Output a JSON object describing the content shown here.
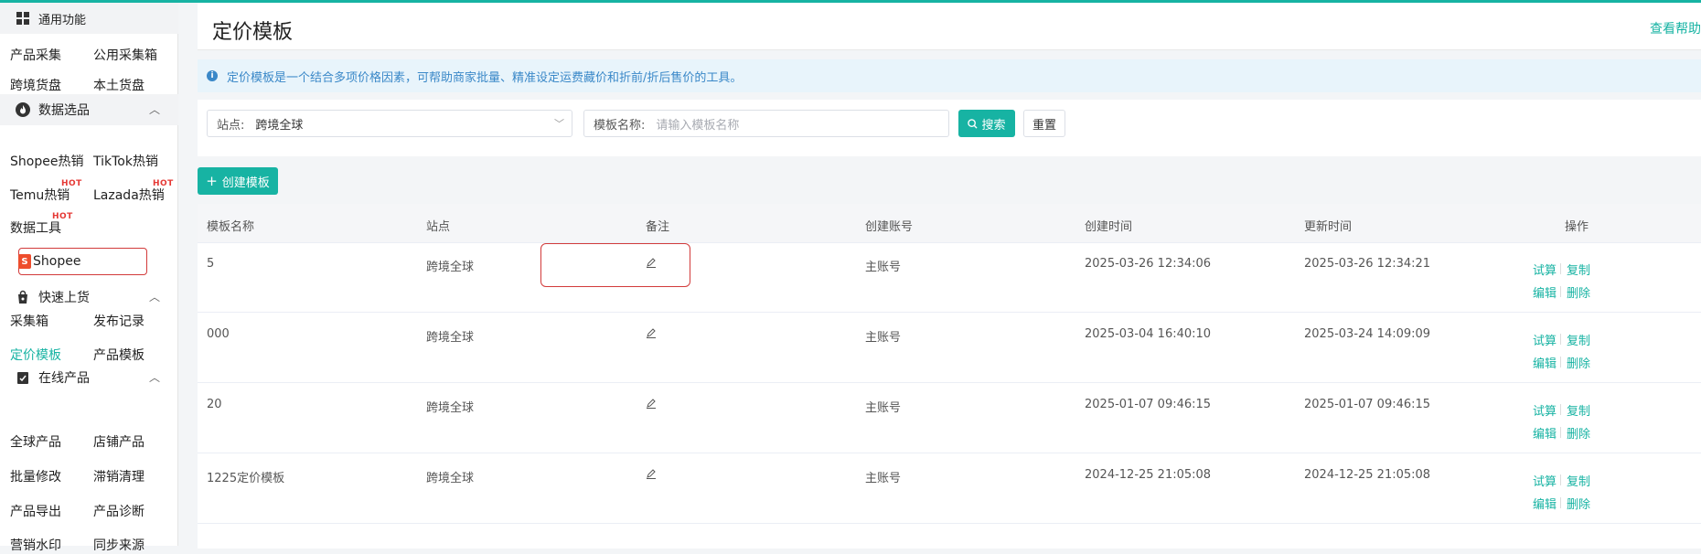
{
  "sidebar": {
    "general": "通用功能",
    "collect": "产品采集",
    "public_box": "公用采集箱",
    "cross_supply": "跨境货盘",
    "local_supply": "本土货盘",
    "data_select": "数据选品",
    "shopee_hot": "Shopee热销",
    "tiktok_hot": "TikTok热销",
    "temu_hot": "Temu热销",
    "lazada_hot": "Lazada热销",
    "data_tools": "数据工具",
    "hot_badge": "HOT",
    "shopee": "Shopee",
    "shopee_logo": "S",
    "quick_list": "快速上货",
    "collect_box": "采集箱",
    "publish_log": "发布记录",
    "pricing_tpl": "定价模板",
    "product_tpl": "产品模板",
    "online_products": "在线产品",
    "global_products": "全球产品",
    "shop_products": "店铺产品",
    "batch_edit": "批量修改",
    "stale_clean": "滞销清理",
    "product_export": "产品导出",
    "product_diag": "产品诊断",
    "marketing_wm": "营销水印",
    "sync_source": "同步来源"
  },
  "header": {
    "title": "定价模板",
    "help": "查看帮助"
  },
  "notice": {
    "icon": "i",
    "text": "定价模板是一个结合多项价格因素，可帮助商家批量、精准设定运费藏价和折前/折后售价的工具。"
  },
  "filter": {
    "site_label": "站点:",
    "site_value": "跨境全球",
    "name_label": "模板名称:",
    "name_placeholder": "请输入模板名称",
    "search": "搜索",
    "reset": "重置"
  },
  "create_button": "创建模板",
  "table": {
    "headers": [
      "模板名称",
      "站点",
      "备注",
      "创建账号",
      "创建时间",
      "更新时间",
      "操作"
    ],
    "actions": {
      "trial": "试算",
      "copy": "复制",
      "edit": "编辑",
      "delete": "删除"
    },
    "rows": [
      {
        "name": "5",
        "site": "跨境全球",
        "account": "主账号",
        "created": "2025-03-26 12:34:06",
        "updated": "2025-03-26 12:34:21"
      },
      {
        "name": "000",
        "site": "跨境全球",
        "account": "主账号",
        "created": "2025-03-04 16:40:10",
        "updated": "2025-03-24 14:09:09"
      },
      {
        "name": "20",
        "site": "跨境全球",
        "account": "主账号",
        "created": "2025-01-07 09:46:15",
        "updated": "2025-01-07 09:46:15"
      },
      {
        "name": "1225定价模板",
        "site": "跨境全球",
        "account": "主账号",
        "created": "2024-12-25 21:05:08",
        "updated": "2024-12-25 21:05:08"
      }
    ]
  },
  "colors": {
    "accent": "#17b3a3",
    "highlight": "#d23a3a",
    "notice_bg": "#e8f4fb",
    "notice_text": "#3a88c8"
  }
}
